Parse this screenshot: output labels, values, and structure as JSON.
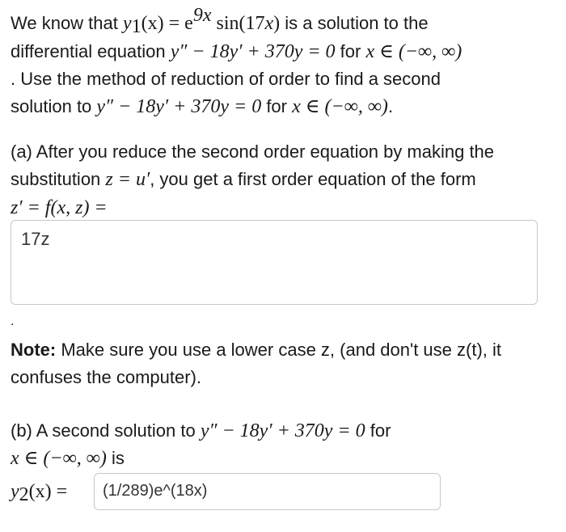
{
  "intro": {
    "l1_a": "We know that ",
    "y1": "y",
    "y1_sub": "1",
    "y1_arg": "(x) = e",
    "exp": "9x",
    "sin": " sin(17",
    "sin_x": "x",
    "sin_end": ")",
    "l1_b": " is a solution to the",
    "l2_a": "differential equation ",
    "ode": "y″ − 18y′ + 370y = 0",
    "for": " for ",
    "domain": "x ∈ (−∞, ∞)",
    "l3": ". Use the method of reduction of order to find a second",
    "l4_a": "solution to ",
    "l4_end": "."
  },
  "part_a": {
    "l1": "(a) After you reduce the second order equation by making the",
    "l2_a": "substitution ",
    "subst": "z = u′",
    "l2_b": ", you get a first order equation of the form",
    "l3": "z′ = f(x, z) =",
    "answer": "17z"
  },
  "dot": ".",
  "note": {
    "bold": "Note:",
    "l1": " Make sure you use a lower case z, (and don't use z(t), it",
    "l2": "confuses the computer)."
  },
  "part_b": {
    "l1_a": "(b) A second solution to ",
    "l1_b": " for",
    "l2_b": " is",
    "y2": "y",
    "y2_sub": "2",
    "y2_rest": "(x) =",
    "answer": "(1/289)e^(18x)"
  }
}
